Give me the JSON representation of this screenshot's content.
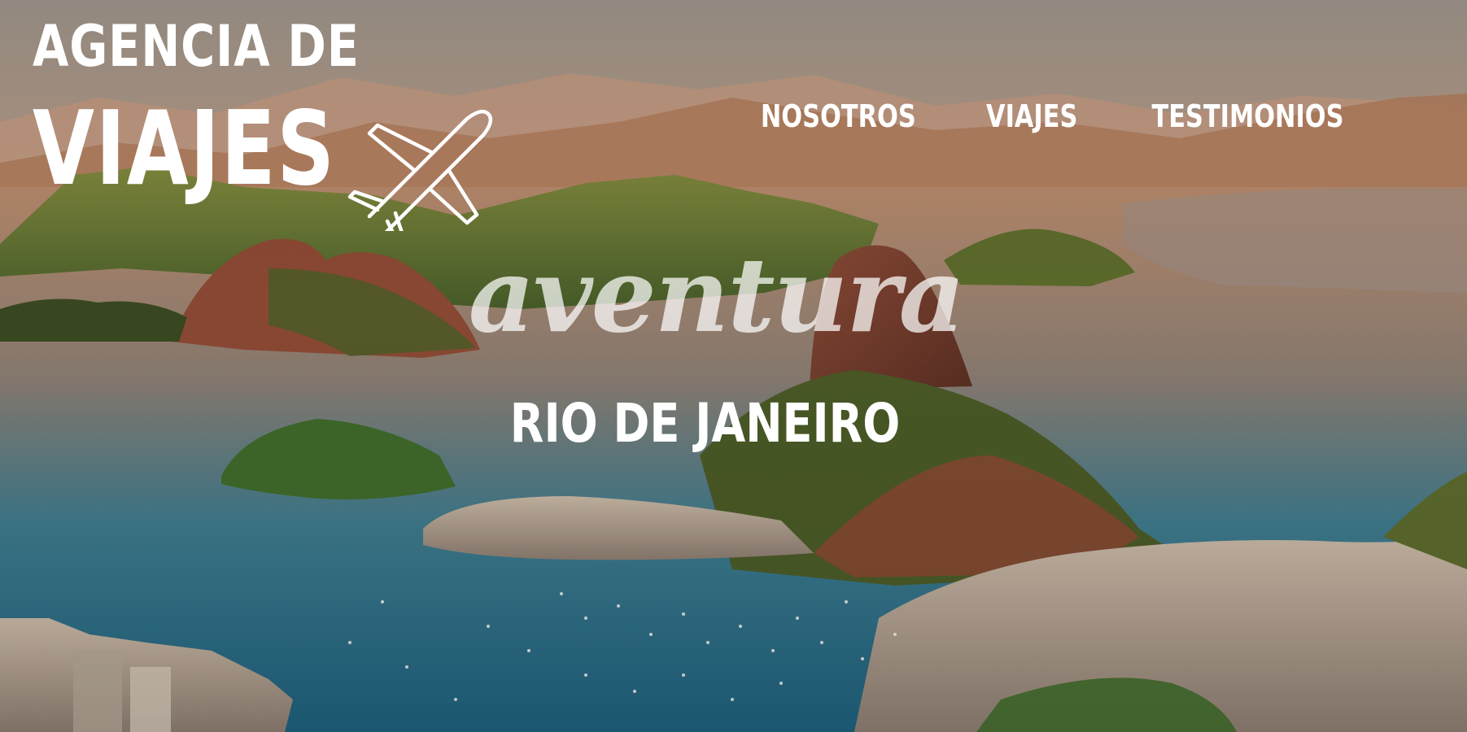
{
  "brand": {
    "line1": "AGENCIA DE",
    "line2": "VIAJES",
    "icon": "airplane-icon"
  },
  "nav": {
    "items": [
      {
        "label": "NOSOTROS"
      },
      {
        "label": "VIAJES"
      },
      {
        "label": "TESTIMONIOS"
      }
    ]
  },
  "hero": {
    "tagline": "aventura",
    "city": "RIO DE JANEIRO"
  },
  "colors": {
    "text": "#ffffff",
    "sky": "#d9a07a",
    "water": "#1f6f8b",
    "hills": "#6f7a2e"
  }
}
